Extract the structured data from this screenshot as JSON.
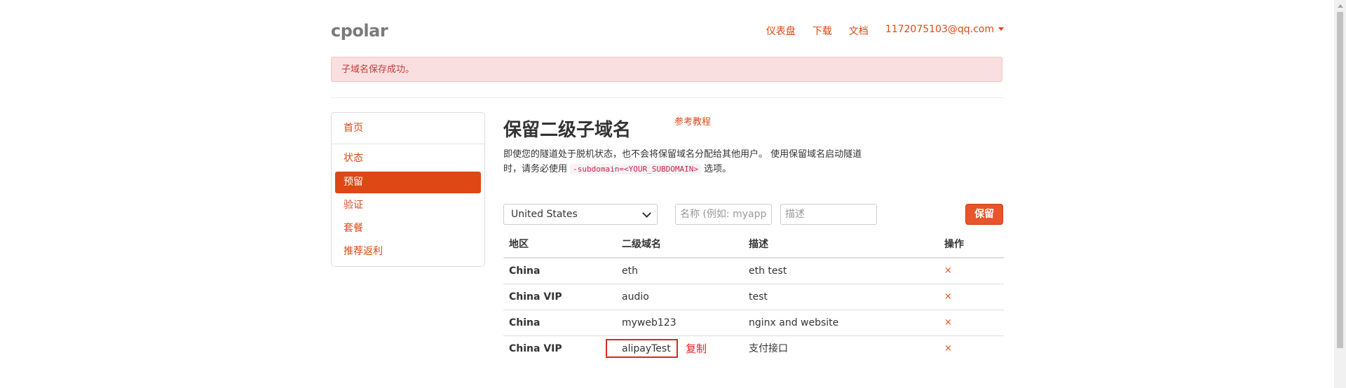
{
  "navbar": {
    "brand": "cpolar",
    "links": [
      "仪表盘",
      "下载",
      "文档"
    ],
    "user": "1172075103@qq.com"
  },
  "alert": {
    "text": "子域名保存成功。"
  },
  "sidebar": {
    "items": [
      {
        "label": "首页",
        "active": false
      },
      {
        "label": "状态",
        "active": false
      },
      {
        "label": "预留",
        "active": true
      },
      {
        "label": "验证",
        "active": false
      },
      {
        "label": "套餐",
        "active": false
      },
      {
        "label": "推荐返利",
        "active": false
      }
    ]
  },
  "main": {
    "title": "保留二级子域名",
    "tutorial_link": "参考教程",
    "desc_line1": "即使您的隧道处于脱机状态，也不会将保留域名分配给其他用户。 使用保留域名启动隧道",
    "desc_line2_prefix": "时，请务必使用",
    "desc_code": "-subdomain=<YOUR_SUBDOMAIN>",
    "desc_line2_suffix": "选项。"
  },
  "form": {
    "region_selected": "United States",
    "name_placeholder": "名称 (例如: myapp)",
    "desc_placeholder": "描述",
    "save_label": "保留"
  },
  "table": {
    "headers": [
      "地区",
      "二级域名",
      "描述",
      "操作"
    ],
    "rows": [
      {
        "region": "China",
        "subdomain": "eth",
        "description": "eth test",
        "action": "×"
      },
      {
        "region": "China VIP",
        "subdomain": "audio",
        "description": "test",
        "action": "×"
      },
      {
        "region": "China",
        "subdomain": "myweb123",
        "description": "nginx and website",
        "action": "×"
      },
      {
        "region": "China VIP",
        "subdomain": "alipayTest",
        "description": "支付接口",
        "action": "×"
      }
    ],
    "copy_label": "复制"
  },
  "colors": {
    "accent": "#dd4814",
    "alert_bg": "#f9dfe0",
    "alert_text": "#c53a3a",
    "highlight": "#e02424"
  }
}
